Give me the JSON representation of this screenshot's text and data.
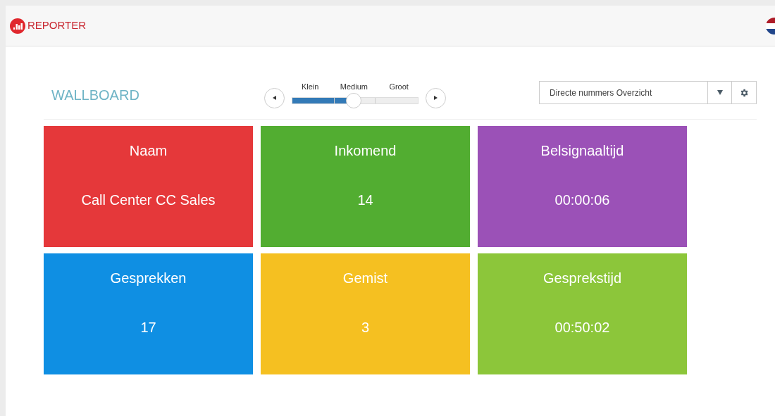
{
  "header": {
    "logo_text": "REPORTER"
  },
  "page_title": "WALLBOARD",
  "size_slider": {
    "labels": [
      "Klein",
      "Medium",
      "Groot"
    ],
    "level": 0.49
  },
  "view_select": {
    "value": "Directe nummers Overzicht"
  },
  "tiles": [
    {
      "label": "Naam",
      "value": "Call Center CC Sales",
      "color": "#e5383a"
    },
    {
      "label": "Inkomend",
      "value": "14",
      "color": "#52ad31"
    },
    {
      "label": "Belsignaaltijd",
      "value": "00:00:06",
      "color": "#9b51b7"
    },
    {
      "label": "Gesprekken",
      "value": "17",
      "color": "#0f8fe3"
    },
    {
      "label": "Gemist",
      "value": "3",
      "color": "#f5c021"
    },
    {
      "label": "Gesprekstijd",
      "value": "00:50:02",
      "color": "#8cc63a"
    }
  ]
}
